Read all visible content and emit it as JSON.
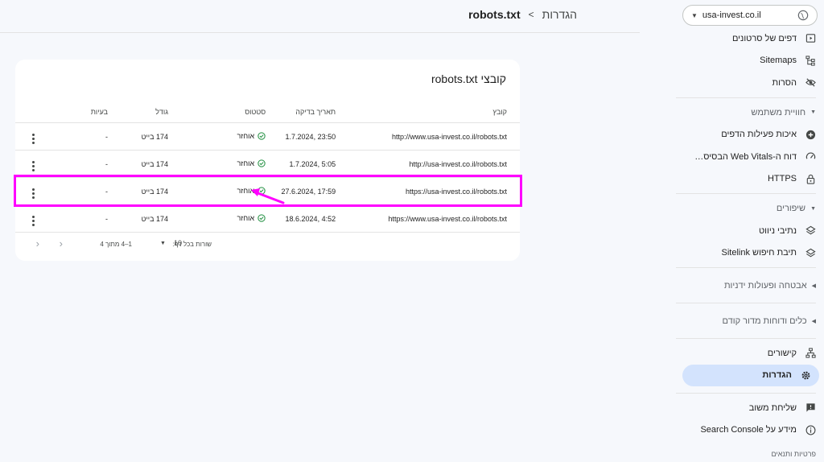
{
  "colors": {
    "accent": "#1e8e3e",
    "highlight": "#ff00ff",
    "active_nav": "#d3e3fd"
  },
  "property": {
    "label": "usa-invest.co.il",
    "icon": "globe-icon"
  },
  "sidebar": {
    "top_items": [
      {
        "label": "דפים של סרטונים",
        "icon": "video-page-icon"
      },
      {
        "label": "Sitemaps",
        "icon": "sitemap-icon"
      },
      {
        "label": "הסרות",
        "icon": "eye-off-icon"
      }
    ],
    "experience": {
      "header": "חוויית משתמש",
      "items": [
        {
          "label": "איכות פעילות הדפים",
          "icon": "plus-circle-icon"
        },
        {
          "label": "דוח ה-Web Vitals הבסיס…",
          "icon": "gauge-icon"
        },
        {
          "label": "HTTPS",
          "icon": "lock-icon"
        }
      ]
    },
    "enhancements": {
      "header": "שיפורים",
      "items": [
        {
          "label": "נתיבי ניווט",
          "icon": "layers-icon"
        },
        {
          "label": "תיבת חיפוש Sitelink",
          "icon": "layers-icon"
        }
      ]
    },
    "security": {
      "header": "אבטחה ופעולות ידניות"
    },
    "legacy": {
      "header": "כלים ודוחות מדור קודם"
    },
    "bottom_items": [
      {
        "label": "קישורים",
        "icon": "links-icon"
      },
      {
        "label": "הגדרות",
        "icon": "gear-icon"
      }
    ],
    "footer_items": [
      {
        "label": "שליחת משוב",
        "icon": "feedback-icon"
      },
      {
        "label": "מידע על Search Console",
        "icon": "info-icon"
      }
    ],
    "cut_off_label": "פרטיות ותנאים"
  },
  "breadcrumb": {
    "parent": "הגדרות",
    "separator": ">",
    "current": "robots.txt"
  },
  "card": {
    "title": "קובצי robots.txt",
    "columns": {
      "file": "קובץ",
      "checked": "תאריך בדיקה",
      "status": "סטטוס",
      "size": "גודל",
      "issues": "בעיות"
    },
    "rows": [
      {
        "file": "http://www.usa-invest.co.il/robots.txt",
        "checked": "23:50 ,1.7.2024",
        "status": "אוחזר",
        "size": "174 בייט",
        "issues": "-"
      },
      {
        "file": "http://usa-invest.co.il/robots.txt",
        "checked": "5:05 ,1.7.2024",
        "status": "אוחזר",
        "size": "174 בייט",
        "issues": "-"
      },
      {
        "file": "https://usa-invest.co.il/robots.txt",
        "checked": "17:59 ,27.6.2024",
        "status": "אוחזר",
        "size": "174 בייט",
        "issues": "-"
      },
      {
        "file": "https://www.usa-invest.co.il/robots.txt",
        "checked": "4:52 ,18.6.2024",
        "status": "אוחזר",
        "size": "174 בייט",
        "issues": "-"
      }
    ],
    "pager": {
      "rows_label": "שורות בכל דף:",
      "rows_value": "10",
      "range": "1–4 מתוך 4"
    }
  }
}
